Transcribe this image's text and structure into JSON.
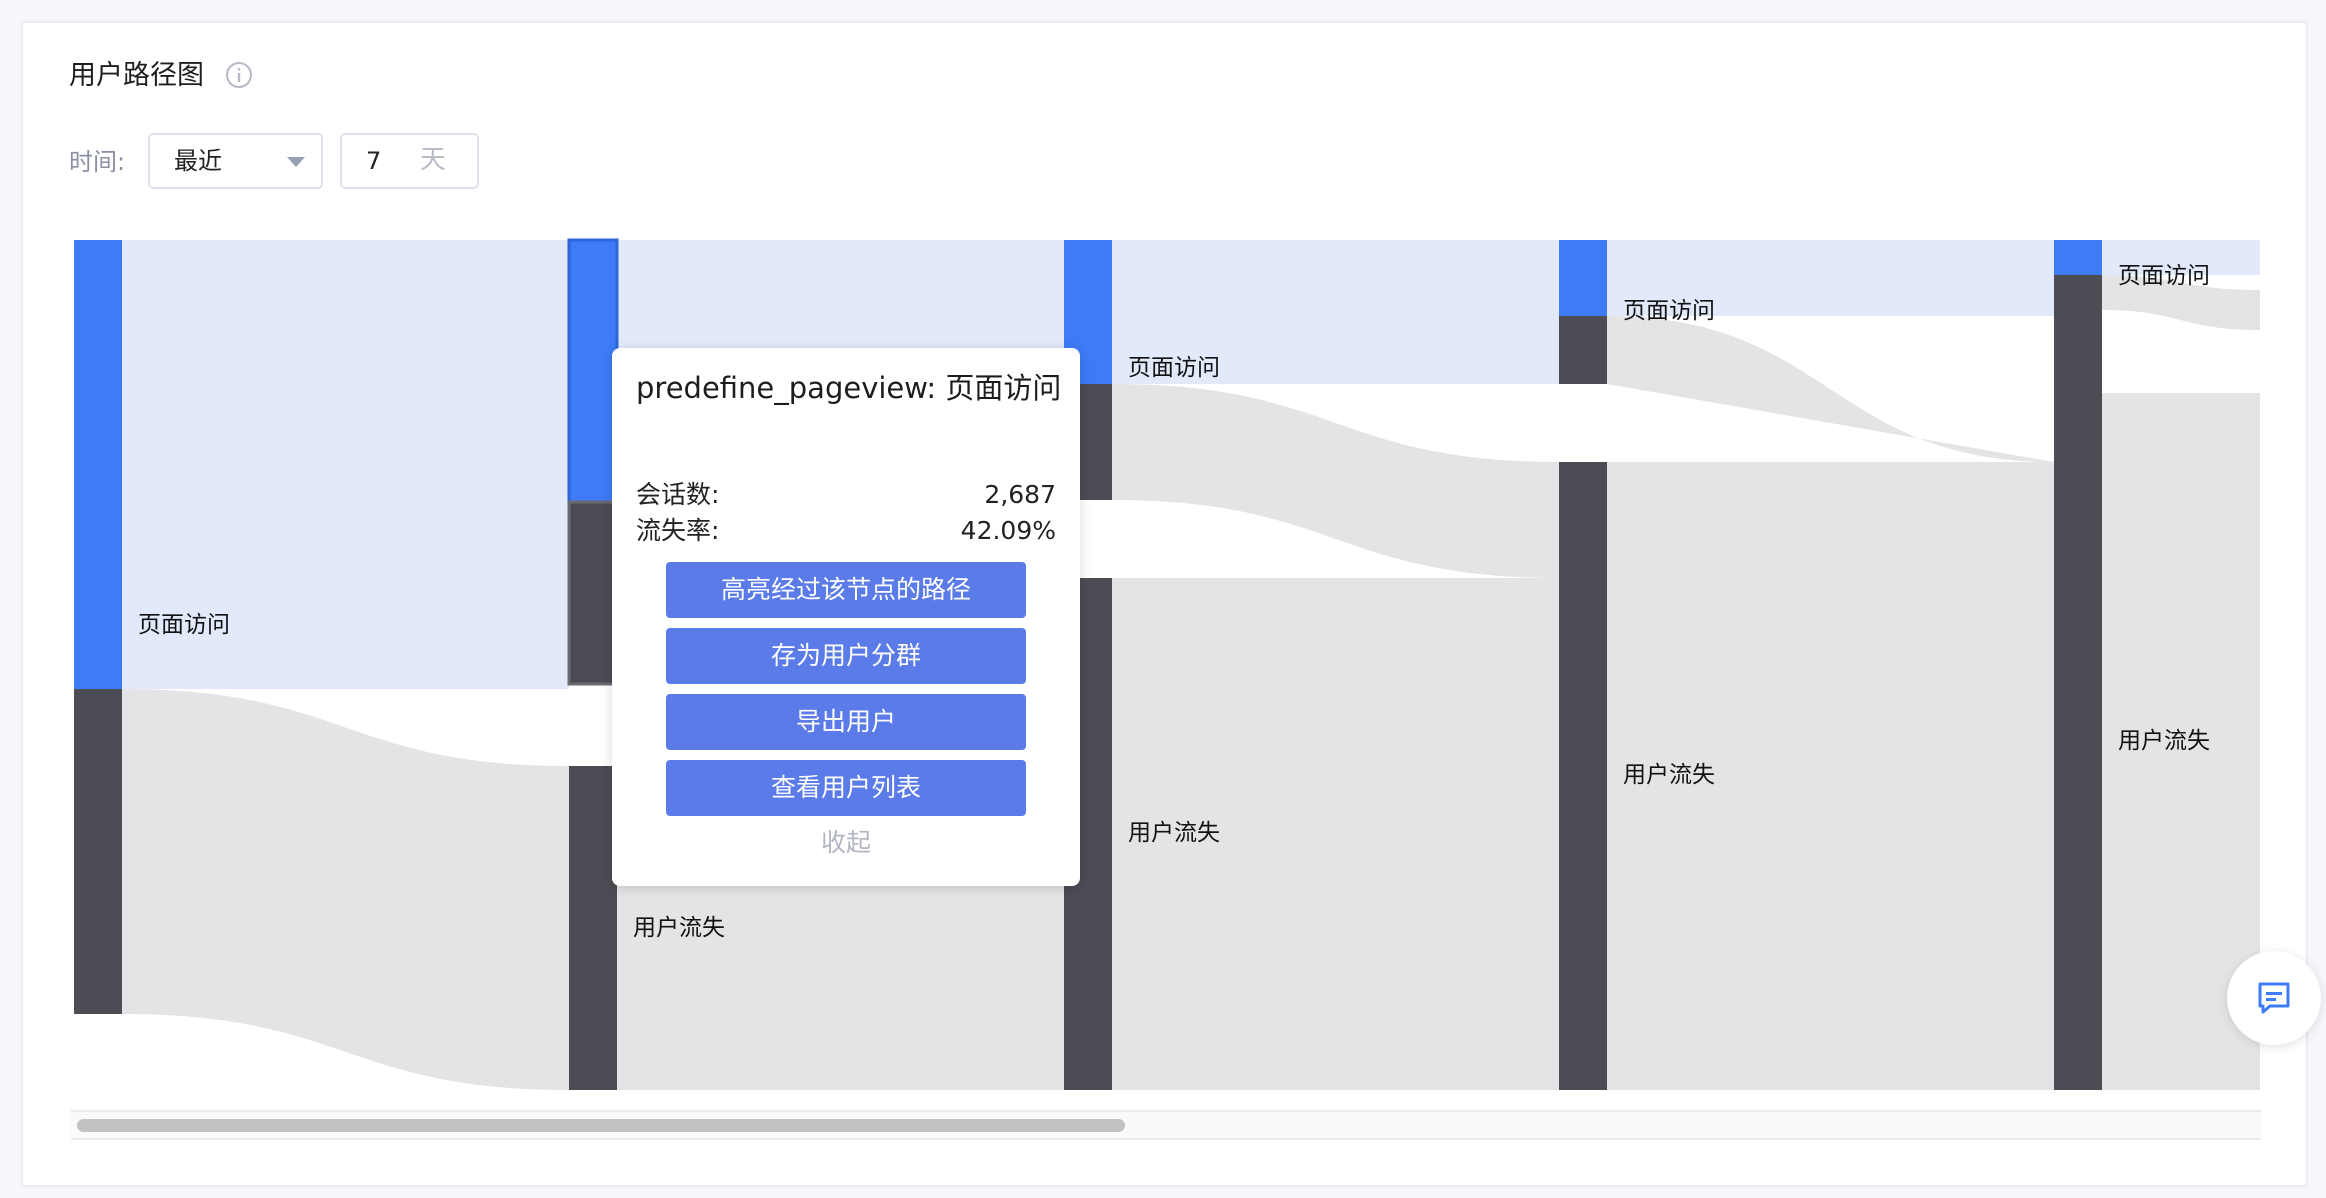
{
  "card": {
    "title": "用户路径图"
  },
  "filter": {
    "time_label": "时间:",
    "range_select": "最近",
    "days_value": "7",
    "days_unit": "天"
  },
  "sankey": {
    "columns": [
      {
        "nodes": [
          {
            "label": "页面访问",
            "type": "page"
          },
          {
            "label": "",
            "type": "churn"
          }
        ]
      },
      {
        "nodes": [
          {
            "label": "",
            "type": "page"
          },
          {
            "label": "用户流失",
            "type": "churn"
          }
        ]
      },
      {
        "nodes": [
          {
            "label": "页面访问",
            "type": "page"
          },
          {
            "label": "用户流失",
            "type": "churn"
          }
        ]
      },
      {
        "nodes": [
          {
            "label": "页面访问",
            "type": "page"
          },
          {
            "label": "用户流失",
            "type": "churn"
          }
        ]
      },
      {
        "nodes": [
          {
            "label": "页面访问",
            "type": "page"
          },
          {
            "label": "用户流失",
            "type": "churn"
          }
        ]
      }
    ],
    "colors": {
      "page_node": "#3d7bf7",
      "churn_node": "#4c4c55",
      "page_flow": "#e1e9fb",
      "churn_flow": "#e4e4e6"
    }
  },
  "popup": {
    "title": "predefine_pageview: 页面访问",
    "sessions_label": "会话数:",
    "sessions_value": "2,687",
    "churn_rate_label": "流失率:",
    "churn_rate_value": "42.09%",
    "actions": {
      "highlight": "高亮经过该节点的路径",
      "save_segment": "存为用户分群",
      "export_users": "导出用户",
      "view_user_list": "查看用户列表"
    },
    "collapse": "收起"
  }
}
